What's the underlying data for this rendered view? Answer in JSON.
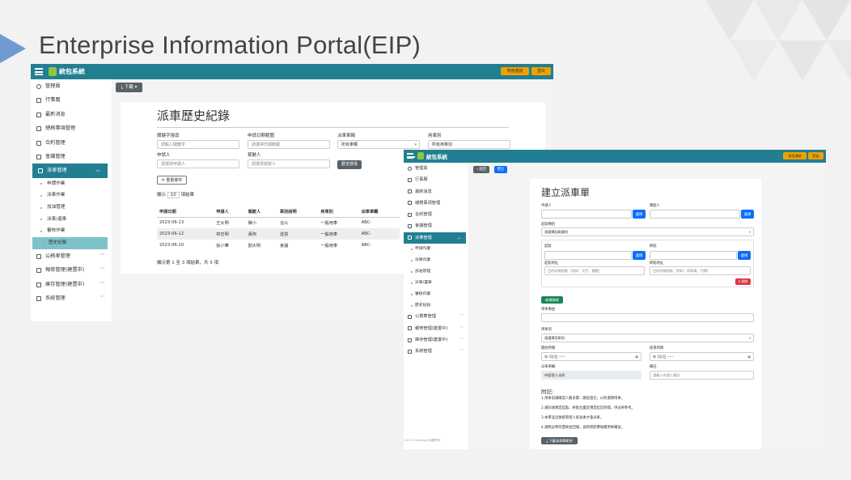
{
  "slide_title": "Enterprise Information Portal(EIP)",
  "colors": {
    "topbar": "#227f91",
    "accent": "#f0a100",
    "active_sub": "#7ec2c9",
    "primary": "#0d6efd",
    "success": "#198754",
    "danger": "#dc3545"
  },
  "topbar": {
    "brand": "統包系統",
    "common_func": "常用連結",
    "logout": "登出"
  },
  "sidebar": {
    "user": "管理員",
    "items": [
      {
        "label": "行事曆",
        "icon": "calendar-icon"
      },
      {
        "label": "最新消息",
        "icon": "news-icon"
      },
      {
        "label": "總務事項管理",
        "icon": "document-icon"
      },
      {
        "label": "合約管理",
        "icon": "contract-icon"
      },
      {
        "label": "會議管理",
        "icon": "meeting-icon"
      }
    ],
    "vehicle": {
      "label": "派車管理",
      "icon": "car-icon"
    },
    "vehicle_subs": [
      "申請作業",
      "派車作業",
      "加油管理",
      "派車/還車",
      "審核作業",
      "歷史紀錄"
    ],
    "groups": [
      {
        "label": "公務車管理",
        "icon": "bus-icon"
      },
      {
        "label": "報修管理(建置中)",
        "icon": "tools-icon"
      },
      {
        "label": "庫存管理(建置中)",
        "icon": "box-icon"
      },
      {
        "label": "系統管理",
        "icon": "database-icon"
      }
    ]
  },
  "history": {
    "download": "下載",
    "title": "派車歷史紀錄",
    "keyword_label": "關鍵字搜尋",
    "keyword_ph": "請輸入關鍵字",
    "date_label": "申請日期範圍",
    "date_ph": "請選擇日期範圍",
    "vehicle_label": "派車車輛",
    "vehicle_value": "所有車輛",
    "purpose_label": "用車別",
    "purpose_value": "所有用車別",
    "applicant_label": "申請人",
    "applicant_ph": "請選擇申請人",
    "driver_label": "駕駛人",
    "driver_ph": "請選擇駕駛人",
    "search_btn": "歷史搜尋",
    "reset_btn": "重置條件",
    "show_prefix": "顯示",
    "show_count": "10",
    "show_suffix": "項結果",
    "columns": [
      "申請日期",
      "申請人",
      "駕駛人",
      "事別說明",
      "用車別",
      "派車車輛"
    ],
    "rows": [
      [
        "2023-06-13",
        "王大明",
        "陳小",
        "洽公",
        "一般用車",
        "ABC-"
      ],
      [
        "2023-06-12",
        "林志明",
        "黃阿",
        "送貨",
        "一般用車",
        "ABC-"
      ],
      [
        "2023-06-10",
        "張小華",
        "劉大明",
        "會議",
        "一般用車",
        "ABC-"
      ]
    ],
    "footer": "顯示第 1 至 3 項結果，共 3 項"
  },
  "form": {
    "back": "返回",
    "build": "建立",
    "title": "建立派車單",
    "applicant": "申請人",
    "driver": "駕駛人",
    "select_btn": "選擇",
    "route_type": "起點類別",
    "route_ph": "請選擇起點類別",
    "origin": "起點",
    "dest": "終點",
    "origin_addr": "起點地址",
    "dest_addr": "終點地址",
    "origin_addr_ph": "目的詳細地點（例如：大門、樓層）",
    "dest_addr_ph": "目的詳細地點（例如：停車場、門牌）",
    "delete": "刪除",
    "add_route": "新增路線",
    "reason": "用車事由",
    "purpose": "用車別",
    "purpose_ph": "請選擇用車別",
    "start": "開始時間",
    "end": "結束時間",
    "date_ph": "年 /月/日 --:--",
    "vehicle": "派車車輛",
    "vehicle_value": "待管理人派車",
    "remark": "備註",
    "remark_ph": "請輸入申請人備註",
    "notes_title": "附記:",
    "notes": [
      "1.用車前請確認人數多寡、路程遠近，以利選擇用車。",
      "2.請詳填預定起點、終點位置及預定起訖時間，供派車參考。",
      "3.本單送出後經管理人核准後才會派車。",
      "4.請務必準時還車並回報，逾時將影響後續用車權益。"
    ],
    "download_btn": "下載派車單範例",
    "footer": "v2.0.0 Copyright 版權所有"
  }
}
